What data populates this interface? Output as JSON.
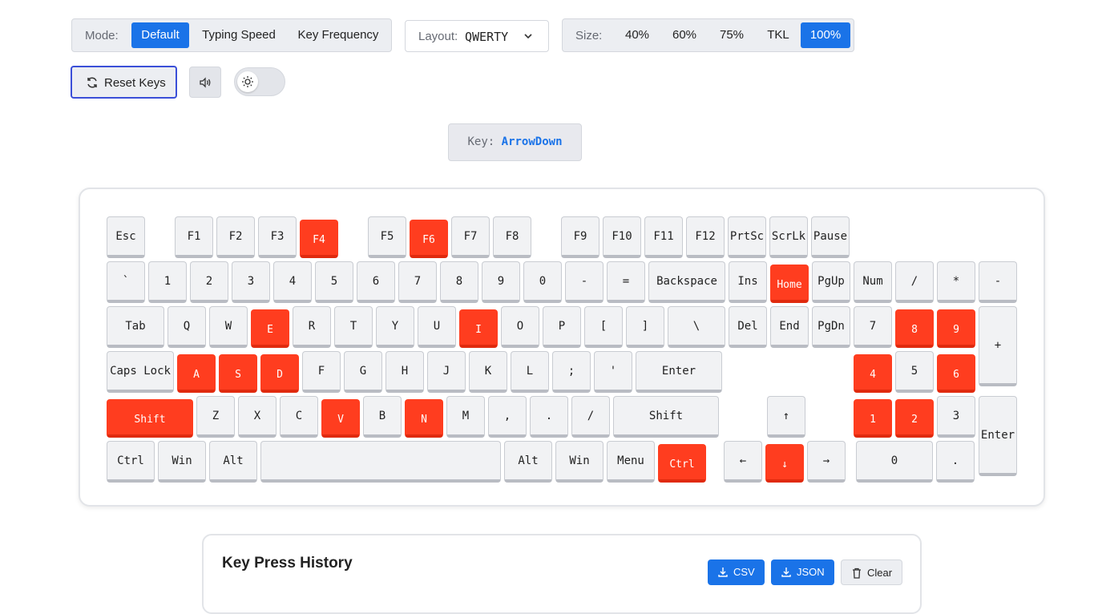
{
  "toolbar": {
    "mode_label": "Mode:",
    "modes": [
      "Default",
      "Typing Speed",
      "Key Frequency"
    ],
    "active_mode": "Default",
    "layout_label": "Layout:",
    "layout_value": "QWERTY",
    "size_label": "Size:",
    "sizes": [
      "40%",
      "60%",
      "75%",
      "TKL",
      "100%"
    ],
    "active_size": "100%",
    "reset_label": "Reset Keys"
  },
  "current_key": {
    "label": "Key:",
    "value": "ArrowDown"
  },
  "colors": {
    "accent": "#1a73e8",
    "hot_key": "#ff3d1f"
  },
  "keyboard": {
    "rows": [
      [
        "Esc",
        "F1",
        "F2",
        "F3",
        "F4",
        "F5",
        "F6",
        "F7",
        "F8",
        "F9",
        "F10",
        "F11",
        "F12",
        "PrtSc",
        "ScrLk",
        "Pause"
      ],
      [
        "`",
        "1",
        "2",
        "3",
        "4",
        "5",
        "6",
        "7",
        "8",
        "9",
        "0",
        "-",
        "=",
        "Backspace",
        "Ins",
        "Home",
        "PgUp",
        "Num",
        "/",
        "*",
        "-"
      ],
      [
        "Tab",
        "Q",
        "W",
        "E",
        "R",
        "T",
        "Y",
        "U",
        "I",
        "O",
        "P",
        "[",
        "]",
        "\\",
        "Del",
        "End",
        "PgDn",
        "7",
        "8",
        "9",
        "+"
      ],
      [
        "Caps Lock",
        "A",
        "S",
        "D",
        "F",
        "G",
        "H",
        "J",
        "K",
        "L",
        ";",
        "'",
        "Enter",
        "4",
        "5",
        "6"
      ],
      [
        "Shift",
        "Z",
        "X",
        "C",
        "V",
        "B",
        "N",
        "M",
        ",",
        ".",
        "/",
        "Shift",
        "↑",
        "1",
        "2",
        "3",
        "Enter"
      ],
      [
        "Ctrl",
        "Win",
        "Alt",
        "",
        "Alt",
        "Win",
        "Menu",
        "Ctrl",
        "←",
        "↓",
        "→",
        "0",
        "."
      ]
    ],
    "pressed": [
      "F4",
      "F6",
      "Home",
      "E",
      "I",
      "8",
      "9",
      "A",
      "S",
      "D",
      "4",
      "6",
      "Shift-left",
      "V",
      "N",
      "1",
      "2",
      "Ctrl-right",
      "↓"
    ]
  },
  "history": {
    "title": "Key Press History",
    "csv_label": "CSV",
    "json_label": "JSON",
    "clear_label": "Clear"
  }
}
